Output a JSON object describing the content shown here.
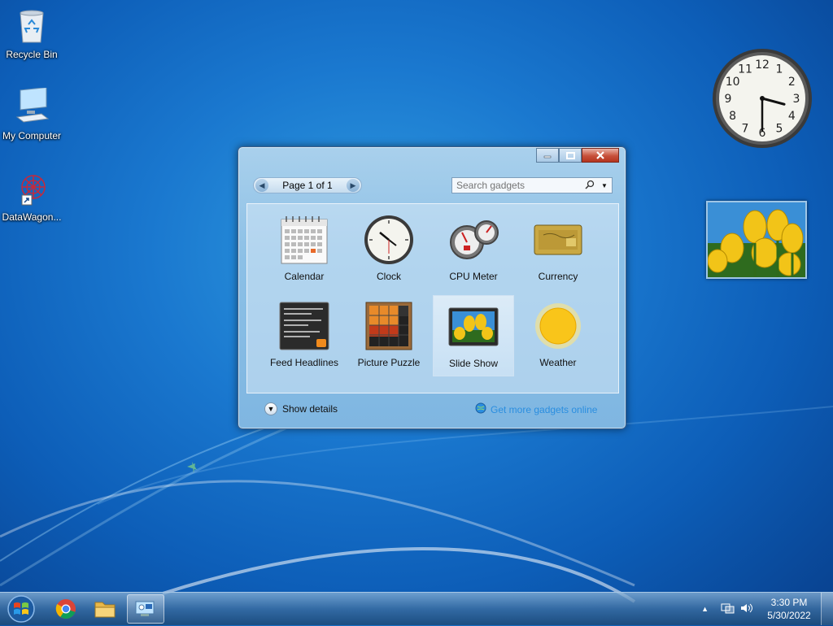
{
  "desktop": {
    "icons": [
      {
        "label": "Recycle Bin",
        "icon": "recycle-bin-icon"
      },
      {
        "label": "My Computer",
        "icon": "computer-icon"
      },
      {
        "label": "DataWagon...",
        "icon": "datawagon-shortcut-icon"
      }
    ]
  },
  "clock_gadget": {
    "hour": 3,
    "minute": 30,
    "numerals": [
      "12",
      "1",
      "2",
      "3",
      "4",
      "5",
      "6",
      "7",
      "8",
      "9",
      "10",
      "11"
    ]
  },
  "gadget_window": {
    "pager_label": "Page 1 of 1",
    "search_placeholder": "Search gadgets",
    "gadgets": [
      {
        "label": "Calendar",
        "icon": "calendar-icon"
      },
      {
        "label": "Clock",
        "icon": "clock-icon"
      },
      {
        "label": "CPU Meter",
        "icon": "cpu-meter-icon"
      },
      {
        "label": "Currency",
        "icon": "currency-icon"
      },
      {
        "label": "Feed Headlines",
        "icon": "feed-headlines-icon"
      },
      {
        "label": "Picture Puzzle",
        "icon": "picture-puzzle-icon"
      },
      {
        "label": "Slide Show",
        "icon": "slide-show-icon",
        "selected": true
      },
      {
        "label": "Weather",
        "icon": "weather-icon"
      }
    ],
    "show_details": "Show details",
    "get_more": "Get more gadgets online"
  },
  "taskbar": {
    "items": [
      {
        "name": "start",
        "icon": "windows-logo-icon"
      },
      {
        "name": "chrome",
        "icon": "chrome-icon"
      },
      {
        "name": "explorer",
        "icon": "folder-icon"
      },
      {
        "name": "gadgets",
        "icon": "gadgets-icon",
        "active": true
      }
    ],
    "time": "3:30 PM",
    "date": "5/30/2022"
  },
  "colors": {
    "desktop": "#1a78cf",
    "taskbar": "#3c6ea0",
    "link": "#2a8ee0"
  }
}
